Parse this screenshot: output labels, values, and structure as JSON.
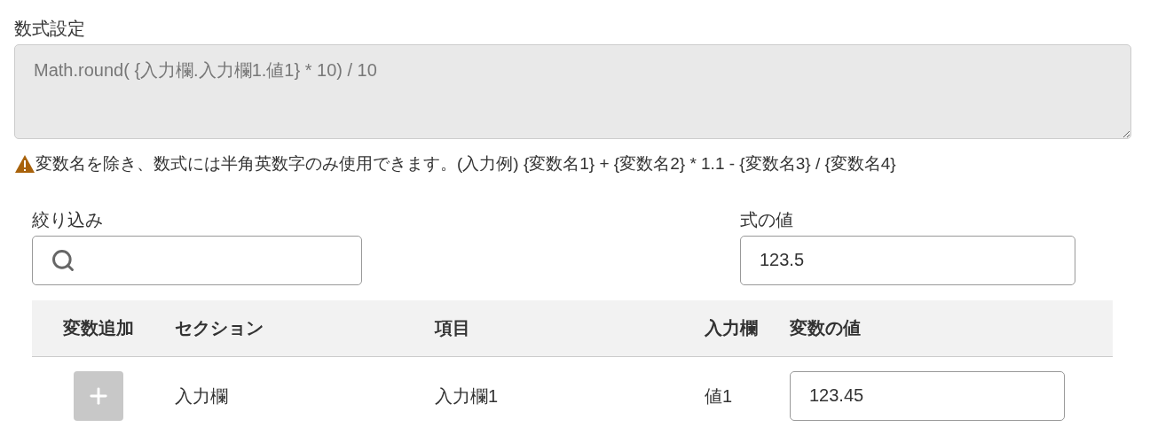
{
  "formula": {
    "label": "数式設定",
    "value": "Math.round( {入力欄.入力欄1.値1} * 10) / 10"
  },
  "warning": "変数名を除き、数式には半角英数字のみ使用できます。(入力例) {変数名1} + {変数名2} * 1.1 - {変数名3} / {変数名4}",
  "filter": {
    "label": "絞り込み"
  },
  "result": {
    "label": "式の値",
    "value": "123.5"
  },
  "table": {
    "columns": [
      "変数追加",
      "セクション",
      "項目",
      "入力欄",
      "変数の値"
    ],
    "rows": [
      {
        "add_disabled": true,
        "section": "入力欄",
        "item": "入力欄1",
        "field": "値1",
        "value": "123.45"
      }
    ]
  }
}
